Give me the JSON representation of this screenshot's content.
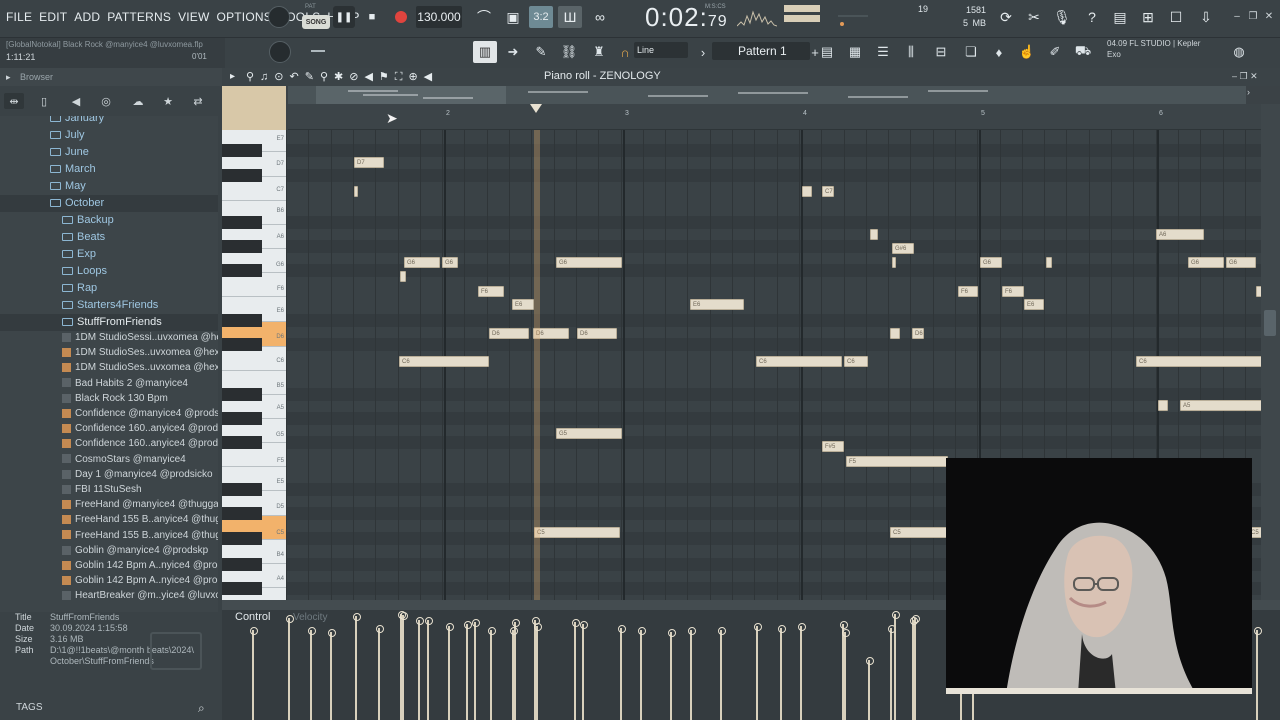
{
  "menus": [
    "FILE",
    "EDIT",
    "ADD",
    "PATTERNS",
    "VIEW",
    "OPTIONS",
    "TOOLS",
    "HELP"
  ],
  "transport": {
    "mode": "SONG",
    "pat_label": "PAT",
    "tempo": "130.000",
    "time": "0:02",
    "time_frac": "79",
    "time_unit": "M:S:CS"
  },
  "stats": {
    "cpu_count": "19",
    "memory": "1581 MB",
    "polyphony": "5"
  },
  "hint": {
    "line1": "[GlobalNotokal] Black Rock @manyice4 @luvxomea.flp",
    "line2": "1:11:21",
    "snap": "0'01"
  },
  "toolbar": {
    "line_mode": "Line",
    "pattern": "Pattern 1"
  },
  "news": {
    "line1": "04.09  FL STUDIO | Kepler",
    "line2": "Exo"
  },
  "browser": {
    "title": "Browser",
    "folders": [
      {
        "label": "January"
      },
      {
        "label": "July"
      },
      {
        "label": "June"
      },
      {
        "label": "March"
      },
      {
        "label": "May"
      },
      {
        "label": "October"
      },
      {
        "label": "Backup"
      },
      {
        "label": "Beats"
      },
      {
        "label": "Exp"
      },
      {
        "label": "Loops"
      },
      {
        "label": "Rap"
      },
      {
        "label": "Starters4Friends"
      },
      {
        "label": "StuffFromFriends"
      }
    ],
    "files": [
      "1DM StudioSessi..uvxomea @hexotag",
      "1DM StudioSes..uvxomea @hexotag",
      "1DM StudioSes..uvxomea @hexotag",
      "Bad Habits 2 @manyice4",
      "Black Rock 130 Bpm",
      "Confidence @manyice4 @prodskp",
      "Confidence 160..anyice4 @prodskp",
      "Confidence 160..anyice4 @prodskp",
      "CosmoStars @manyice4",
      "Day 1 @manyice4 @prodsicko",
      "FBI 11StuSesh",
      "FreeHand @manyice4 @thuggah",
      "FreeHand 155 B..anyice4 @thuggah",
      "FreeHand 155 B..anyice4 @thuggah",
      "Goblin @manyice4 @prodskp",
      "Goblin 142 Bpm A..nyice4 @prodskp",
      "Goblin 142 Bpm A..nyice4 @prodskp",
      "HeartBreaker @m..yice4 @luvxomea"
    ]
  },
  "info": {
    "title_key": "Title",
    "title": "StuffFromFriends",
    "date_key": "Date",
    "date": "30.09.2024 1:15:58",
    "size_key": "Size",
    "size": "3.16 MB",
    "path_key": "Path",
    "path1": "D:\\1@!!1beats\\@month beats\\2024\\",
    "path2": "October\\StuffFromFriends",
    "tags": "TAGS"
  },
  "piano_roll": {
    "title": "Piano roll - ZENOLOGY",
    "bars": [
      "2",
      "3",
      "4",
      "5",
      "6"
    ],
    "keys": [
      "E7",
      "D7",
      "C7",
      "B6",
      "A6",
      "G6",
      "F6",
      "E6",
      "D6",
      "C6",
      "B5",
      "A5",
      "G5",
      "F5",
      "E5",
      "D5",
      "C5",
      "B4",
      "A4"
    ]
  },
  "control": {
    "label": "Control",
    "target": "Velocity"
  },
  "colors": {
    "note": "#e4dccb",
    "highlight_key": "#f2b26b",
    "background": "#3a4246",
    "playhead": "#dcaa6e"
  }
}
